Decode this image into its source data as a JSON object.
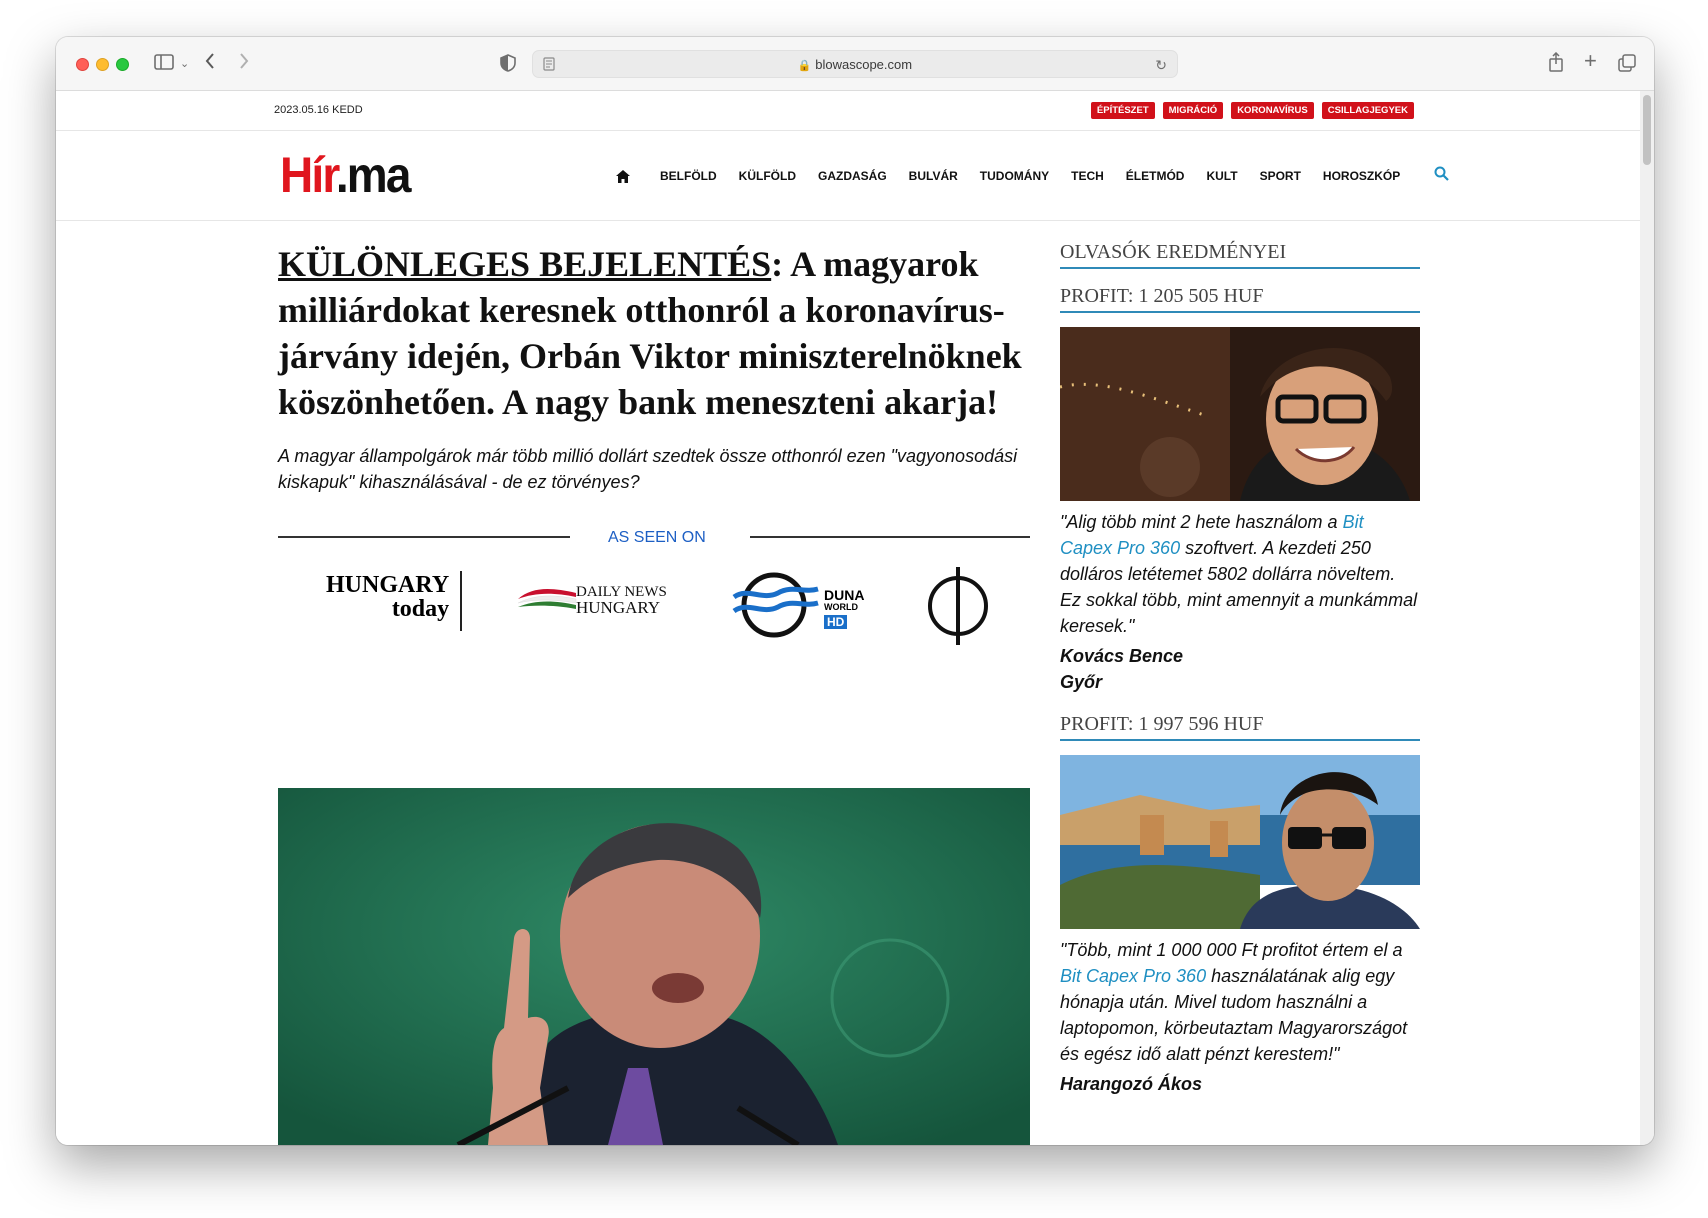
{
  "browser": {
    "url": "blowascope.com"
  },
  "topbar": {
    "date": "2023.05.16 KEDD",
    "tags": [
      "ÉPÍTÉSZET",
      "MIGRÁCIÓ",
      "KORONAVÍRUS",
      "CSILLAGJEGYEK"
    ]
  },
  "header": {
    "logo_red": "Hír",
    "logo_black": ".ma",
    "nav": [
      "BELFÖLD",
      "KÜLFÖLD",
      "GAZDASÁG",
      "BULVÁR",
      "TUDOMÁNY",
      "TECH",
      "ÉLETMÓD",
      "KULT",
      "SPORT",
      "HOROSZKÓP"
    ]
  },
  "article": {
    "headline_lead": "KÜLÖNLEGES BEJELENTÉS",
    "headline_rest": ": A magyarok milliárdokat keresnek otthonról a koronavírus-járvány idején, Orbán Viktor miniszterelnöknek köszönhetően. A nagy bank meneszteni akarja!",
    "lead": "A magyar állampolgárok már több millió dollárt szedtek össze otthonról ezen \"vagyonosodási kiskapuk\" kihasználásával - de ez törvényes?",
    "as_seen_on": "AS SEEN ON",
    "media_logos": {
      "hungary_today_1": "HUNGARY",
      "hungary_today_2": "today",
      "daily_news_1": "DAILY NEWS",
      "daily_news_2": "HUNGARY",
      "duna_1": "DUNA",
      "duna_2": "WORLD",
      "duna_3": "HD"
    }
  },
  "sidebar": {
    "title": "OLVASÓK EREDMÉNYEI",
    "testimonials": [
      {
        "profit": "PROFIT: 1 205 505 HUF",
        "quote_before": "\"Alig több mint 2 hete használom a ",
        "quote_link": "Bit Capex Pro 360",
        "quote_after": " szoftvert. A kezdeti 250 dolláros letétemet 5802 dollárra növeltem. Ez sokkal több, mint amennyit a munkámmal keresek.\"",
        "name": "Kovács Bence",
        "city": "Győr"
      },
      {
        "profit": "PROFIT: 1 997 596 HUF",
        "quote_before": "\"Több, mint 1 000 000 Ft profitot értem el a ",
        "quote_link": "Bit Capex Pro 360",
        "quote_after": " használatának alig egy hónapja után. Mivel tudom használni a laptopomon, körbeutaztam Magyarországot és egész idő alatt pénzt kerestem!\"",
        "name": "Harangozó Ákos",
        "city": ""
      }
    ]
  }
}
